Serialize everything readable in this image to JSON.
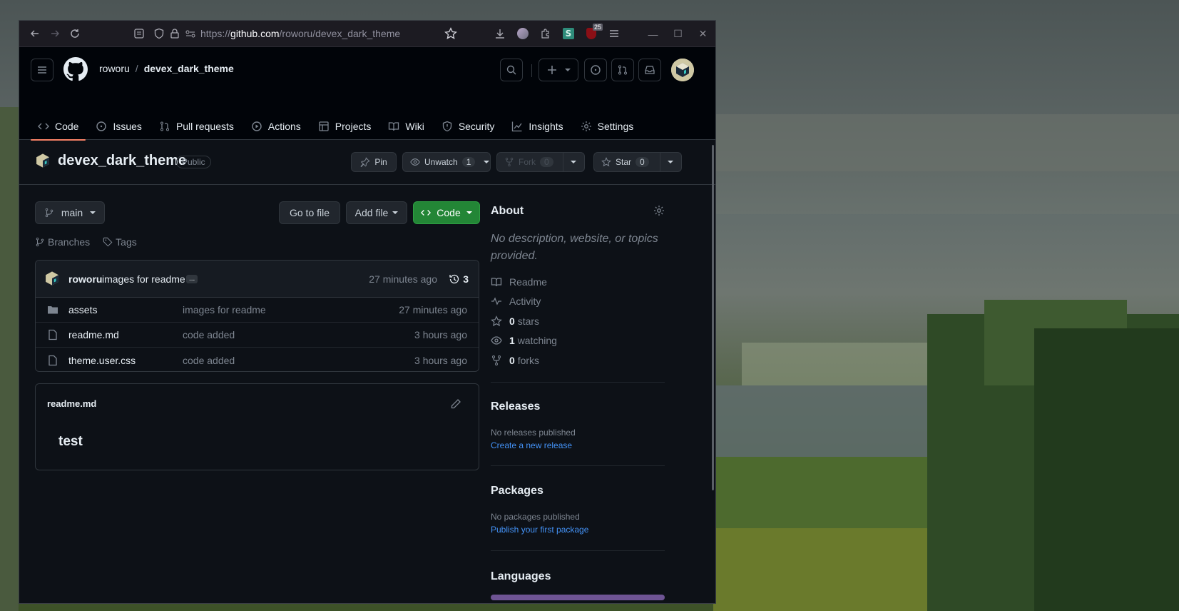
{
  "browser": {
    "url_prefix": "https://",
    "url_domain": "github.com",
    "url_path": "/roworu/devex_dark_theme",
    "extension_badge": "25"
  },
  "header": {
    "owner": "roworu",
    "separator": "/",
    "repo": "devex_dark_theme"
  },
  "tabs": [
    {
      "label": "Code",
      "icon": "code-icon"
    },
    {
      "label": "Issues",
      "icon": "issue-icon"
    },
    {
      "label": "Pull requests",
      "icon": "pull-request-icon"
    },
    {
      "label": "Actions",
      "icon": "play-icon"
    },
    {
      "label": "Projects",
      "icon": "table-icon"
    },
    {
      "label": "Wiki",
      "icon": "book-icon"
    },
    {
      "label": "Security",
      "icon": "shield-icon"
    },
    {
      "label": "Insights",
      "icon": "graph-icon"
    },
    {
      "label": "Settings",
      "icon": "gear-icon"
    }
  ],
  "repo": {
    "name": "devex_dark_theme",
    "visibility": "Public",
    "pin_label": "Pin",
    "watch_label": "Unwatch",
    "watch_count": "1",
    "fork_label": "Fork",
    "fork_count": "0",
    "star_label": "Star",
    "star_count": "0"
  },
  "toolbar": {
    "branch": "main",
    "goto_file": "Go to file",
    "add_file": "Add file",
    "code": "Code",
    "branches": "Branches",
    "tags": "Tags"
  },
  "commit": {
    "author": "roworu",
    "message": "images for readme",
    "ellipsis": "...",
    "time": "27 minutes ago",
    "count": "3"
  },
  "files": [
    {
      "name": "assets",
      "type": "folder",
      "message": "images for readme",
      "time": "27 minutes ago"
    },
    {
      "name": "readme.md",
      "type": "file",
      "message": "code added",
      "time": "3 hours ago"
    },
    {
      "name": "theme.user.css",
      "type": "file",
      "message": "code added",
      "time": "3 hours ago"
    }
  ],
  "readme": {
    "filename": "readme.md",
    "content": "test"
  },
  "about": {
    "title": "About",
    "description": "No description, website, or topics provided.",
    "items": [
      {
        "icon": "book-icon",
        "count": "",
        "label": "Readme"
      },
      {
        "icon": "pulse-icon",
        "count": "",
        "label": "Activity"
      },
      {
        "icon": "star-icon",
        "count": "0",
        "label": "stars"
      },
      {
        "icon": "eye-icon",
        "count": "1",
        "label": "watching"
      },
      {
        "icon": "fork-icon",
        "count": "0",
        "label": "forks"
      }
    ]
  },
  "releases": {
    "title": "Releases",
    "empty": "No releases published",
    "link": "Create a new release"
  },
  "packages": {
    "title": "Packages",
    "empty": "No packages published",
    "link": "Publish your first package"
  },
  "languages": {
    "title": "Languages",
    "bar_color": "#6e5494"
  },
  "colors": {
    "accent_green": "#238636",
    "link_blue": "#4493f8",
    "tab_underline": "#f78166"
  }
}
